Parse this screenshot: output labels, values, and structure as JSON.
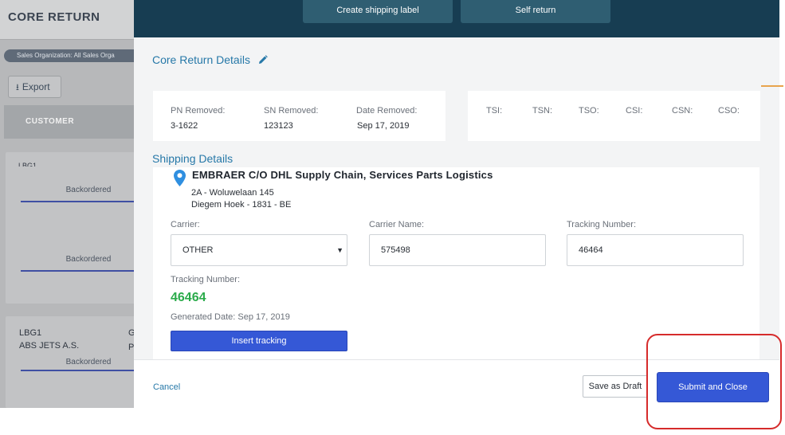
{
  "background": {
    "page_title": "CORE RETURN",
    "org_filter": "Sales Organization: All Sales Orga",
    "export_label": "Export",
    "table_header": "CUSTOMER",
    "row1_partial": "LBG1",
    "row1_status_a": "Backordered",
    "row1_status_b": "Backordered",
    "row2_code": "LBG1",
    "row2_customer": "ABS JETS A.S.",
    "row2_col2_a": "G",
    "row2_col2_b": "P",
    "row2_status": "Backordered"
  },
  "modal": {
    "top_buttons": {
      "create_label": "Create shipping label",
      "self_return": "Self return"
    },
    "core_return": {
      "title": "Core Return Details",
      "pn_label": "PN Removed:",
      "pn_value": "3-1622",
      "sn_label": "SN Removed:",
      "sn_value": "123123",
      "date_label": "Date Removed:",
      "date_value": "Sep 17, 2019",
      "tsi_label": "TSI:",
      "tsn_label": "TSN:",
      "tso_label": "TSO:",
      "csi_label": "CSI:",
      "csn_label": "CSN:",
      "cso_label": "CSO:"
    },
    "shipping": {
      "title": "Shipping Details",
      "address_name": "EMBRAER C/O DHL Supply Chain, Services Parts Logistics",
      "address_line1": "2A - Woluwelaan 145",
      "address_line2": "Diegem Hoek - 1831 - BE",
      "carrier_label": "Carrier:",
      "carrier_value": "OTHER",
      "carrier_name_label": "Carrier Name:",
      "carrier_name_value": "575498",
      "tracking_number_label": "Tracking Number:",
      "tracking_number_value": "46464",
      "tracking_display_label": "Tracking Number:",
      "tracking_display_value": "46464",
      "generated_date": "Generated Date: Sep 17, 2019",
      "insert_tracking": "Insert tracking"
    },
    "footer": {
      "cancel": "Cancel",
      "save_draft": "Save as Draft",
      "submit_close": "Submit and Close"
    }
  },
  "colors": {
    "modal_header": "#173d52",
    "primary_button": "#3558d6",
    "link_blue": "#2678a8",
    "tracking_green": "#2bab4b",
    "highlight_red": "#d62b2b"
  },
  "icons": {
    "export": "download-icon",
    "edit": "pencil-icon",
    "location": "map-pin-icon",
    "select": "chevron-down-icon"
  }
}
